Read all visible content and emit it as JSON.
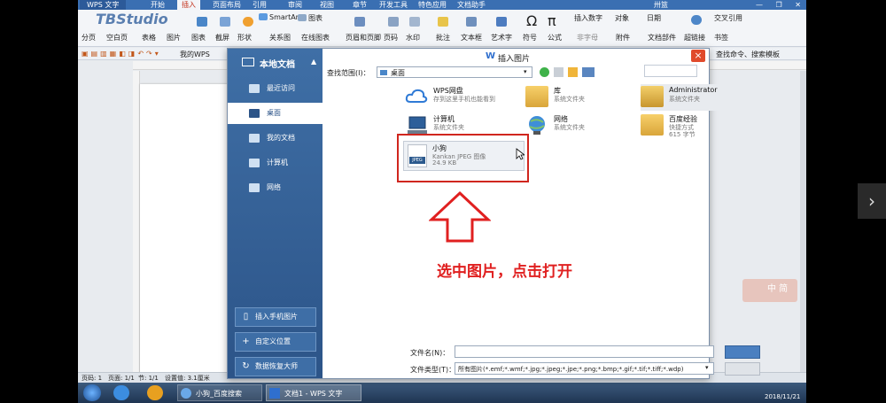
{
  "app": {
    "title": "WPS 文字",
    "menu_tabs": [
      "开始",
      "插入",
      "页面布局",
      "引用",
      "审阅",
      "视图",
      "章节",
      "开发工具",
      "特色应用",
      "文档助手"
    ],
    "active_tab": "插入",
    "logo_text": "TBStudio",
    "user": "卅篮"
  },
  "ribbon": {
    "row1": [
      "SmartArt",
      "图表",
      "截屏",
      "形状",
      "关系图",
      "在线图表",
      "页眉和页脚",
      "页码",
      "水印",
      "批注",
      "文本框",
      "艺术字",
      "符号",
      "公式",
      "插入数字",
      "对象",
      "日期",
      "超链接",
      "书签",
      "交叉引用"
    ],
    "row2": [
      "分页",
      "空白页",
      "表格",
      "图片"
    ],
    "row2b": [
      "非字母",
      "附件",
      "文档部件"
    ]
  },
  "quickbar": {
    "items": [
      "我的WPS"
    ],
    "search_placeholder": "查找命令、搜索模板"
  },
  "dialog": {
    "title": "插入图片",
    "side_header": "本地文档",
    "side_items": [
      {
        "label": "最近访问"
      },
      {
        "label": "桌面"
      },
      {
        "label": "我的文档"
      },
      {
        "label": "计算机"
      },
      {
        "label": "网络"
      }
    ],
    "side_active": 1,
    "side_buttons": [
      {
        "label": "插入手机图片"
      },
      {
        "label": "自定义位置"
      },
      {
        "label": "数据恢复大师"
      }
    ],
    "lookin_label": "查找范围(I)：",
    "lookin_value": "桌面",
    "files": [
      {
        "name": "WPS网盘",
        "desc": "存到这里手机也能看到"
      },
      {
        "name": "库",
        "desc": "系统文件夹"
      },
      {
        "name": "Administrator",
        "desc": "系统文件夹"
      },
      {
        "name": "计算机",
        "desc": "系统文件夹"
      },
      {
        "name": "网络",
        "desc": "系统文件夹"
      },
      {
        "name": "百度经验",
        "desc": "快捷方式",
        "desc2": "615 字节"
      },
      {
        "name": "小狗",
        "desc": "Kankan JPEG 图像",
        "desc2": "24.9 KB",
        "badge": "JPEG"
      }
    ],
    "annotation": "选中图片，点击打开",
    "filename_label": "文件名(N)：",
    "filename_value": "",
    "filetype_label": "文件类型(T)：",
    "filetype_value": "所有图片(*.emf;*.wmf;*.jpg;*.jpeg;*.jpe;*.png;*.bmp;*.gif;*.tif;*.tiff;*.wdp)",
    "close_glyph": "×"
  },
  "statusbar": {
    "page": "页码: 1",
    "pages": "页面: 1/1",
    "section": "节: 1/1",
    "setting": "设置值: 3.1厘米"
  },
  "taskbar": {
    "items": [
      {
        "label": "小狗_百度搜索"
      },
      {
        "label": "文档1 - WPS 文字"
      }
    ],
    "date": "2018/11/21"
  },
  "ime": {
    "label": "中 简"
  },
  "colors": {
    "title_blue": "#3a6fb2",
    "side_blue": "#2c5488",
    "highlight_red": "#d0261e",
    "annotation_red": "#e02020",
    "close_red": "#e04a2c"
  }
}
